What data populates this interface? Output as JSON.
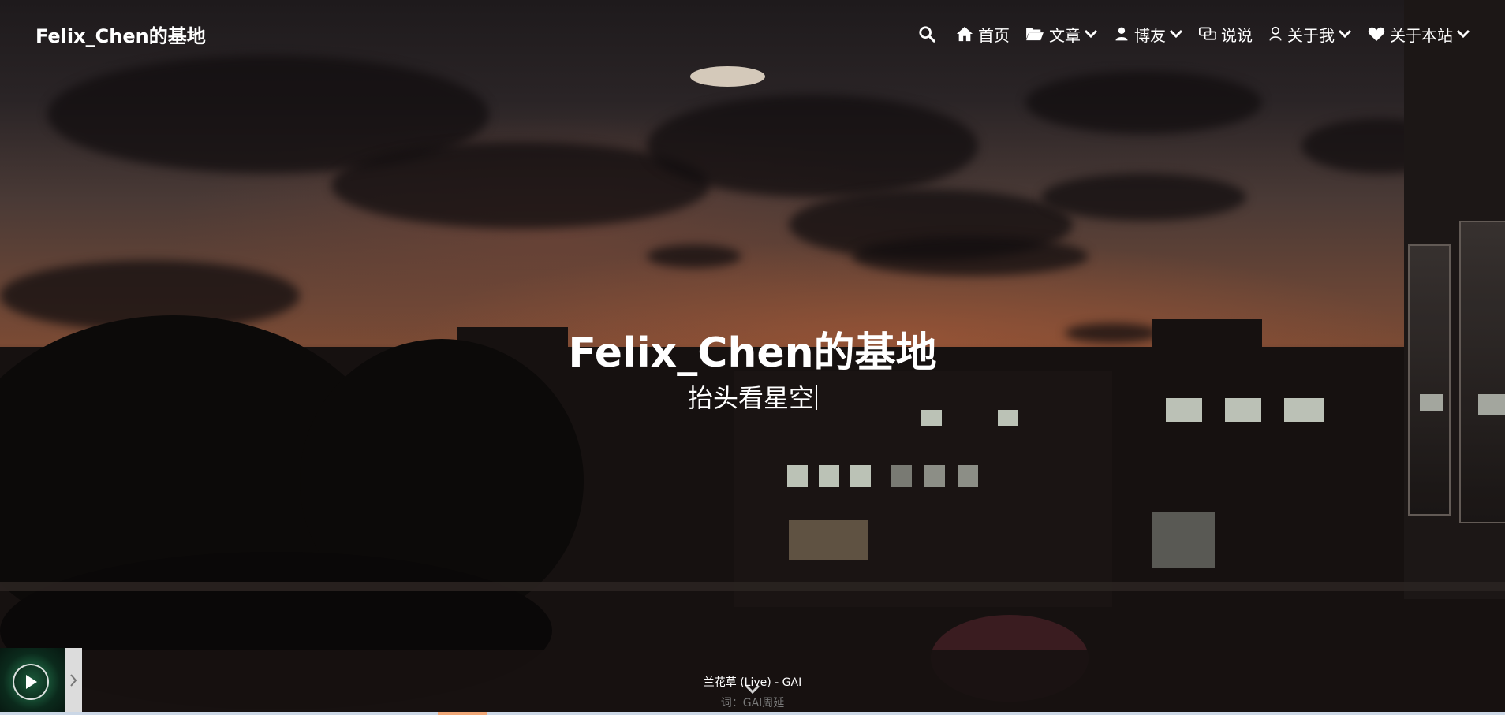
{
  "nav": {
    "brand": "Felix_Chen的基地",
    "items": [
      {
        "label": "首页",
        "icon": "home-icon",
        "dropdown": false
      },
      {
        "label": "文章",
        "icon": "folder-open-icon",
        "dropdown": true
      },
      {
        "label": "博友",
        "icon": "user-friends-icon",
        "dropdown": true
      },
      {
        "label": "说说",
        "icon": "comments-icon",
        "dropdown": false
      },
      {
        "label": "关于我",
        "icon": "user-icon",
        "dropdown": true
      },
      {
        "label": "关于本站",
        "icon": "heart-icon",
        "dropdown": true
      }
    ]
  },
  "hero": {
    "title": "Felix_Chen的基地",
    "subtitle": "抬头看星空"
  },
  "music": {
    "song": "兰花草 (Live) - GAI",
    "lyric": "词：GAI周延"
  },
  "colors": {
    "text": "#ffffff",
    "bottom_bar": "#cbd7e6",
    "bottom_accent": "#f0a878"
  }
}
